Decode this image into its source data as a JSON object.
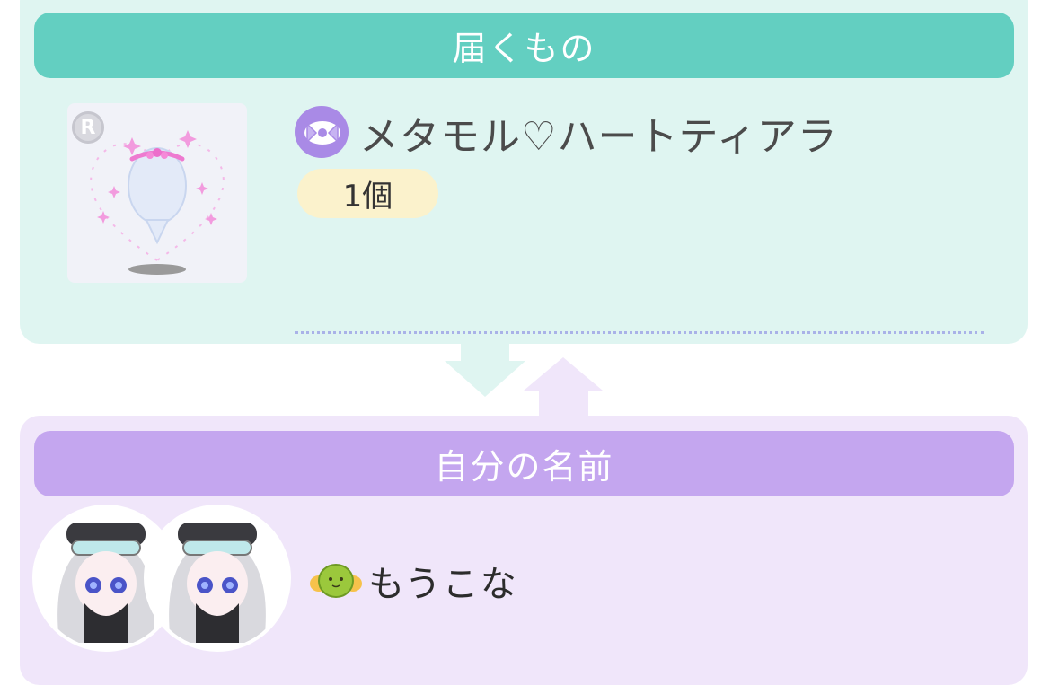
{
  "receive_section": {
    "header": "届くもの",
    "item": {
      "rarity": "R",
      "category_icon": "ribbon-category-icon",
      "name": "メタモル♡ハートティアラ",
      "quantity": "1個"
    }
  },
  "name_section": {
    "header": "自分の名前",
    "user": {
      "name": "もうこな",
      "icon": "mochi-character-icon"
    }
  },
  "colors": {
    "receive_header": "#63cfc1",
    "receive_panel": "#dff5f1",
    "name_header": "#c4a6ef",
    "name_panel": "#f0e6fa",
    "quantity_badge": "#fbf2cc"
  }
}
